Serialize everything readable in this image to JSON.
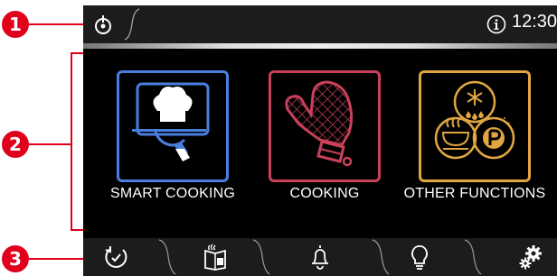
{
  "callouts": [
    "1",
    "2",
    "3"
  ],
  "status_bar": {
    "time": "12:30",
    "power_icon": "power-icon",
    "info_icon": "info-icon"
  },
  "tiles": [
    {
      "label": "SMART COOKING",
      "color": "#4a7fe0",
      "icon": "chef-cloche-icon"
    },
    {
      "label": "COOKING",
      "color": "#c8405a",
      "icon": "oven-mitt-icon"
    },
    {
      "label": "OTHER FUNCTIONS",
      "color": "#e0a640",
      "icon": "functions-icon"
    }
  ],
  "nav_bar": [
    {
      "icon": "timer-icon"
    },
    {
      "icon": "recipe-book-icon"
    },
    {
      "icon": "bell-icon"
    },
    {
      "icon": "lightbulb-icon"
    },
    {
      "icon": "settings-icon"
    }
  ]
}
